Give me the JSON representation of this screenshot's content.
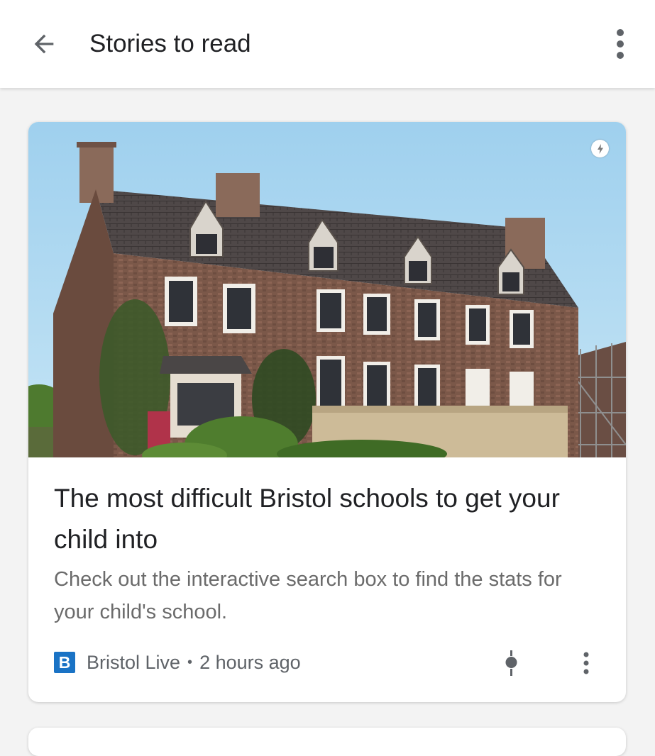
{
  "app_bar": {
    "title": "Stories to read",
    "back_icon": "arrow-back-icon",
    "menu_icon": "more-vert-icon"
  },
  "story_card": {
    "image_icon": "amp-lightning-icon",
    "headline": "The most difficult Bristol schools to get your child into",
    "snippet": "Check out the interactive search box to find the stats for your child's school.",
    "publisher_logo_letter": "B",
    "publisher": "Bristol Live",
    "separator": "•",
    "time_ago": "2 hours ago",
    "tune_icon": "tune-icon",
    "menu_icon": "more-vert-icon"
  },
  "colors": {
    "publisher_logo": "#1a73c5",
    "sky": "#a9d6ef",
    "brick": "#7a5848"
  }
}
